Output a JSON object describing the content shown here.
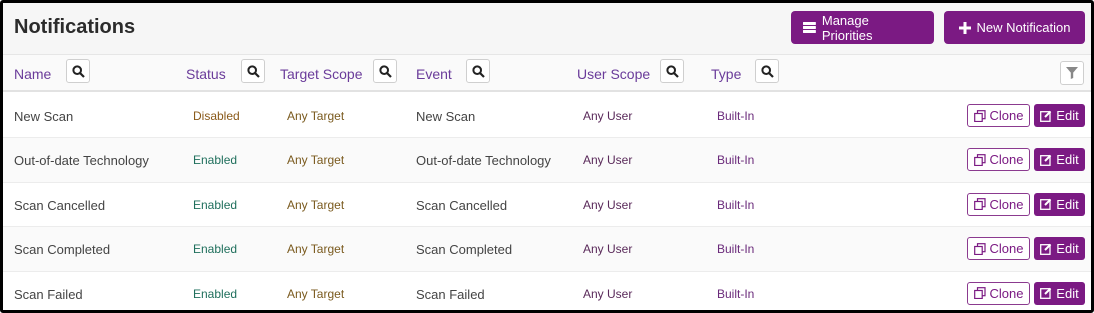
{
  "header": {
    "title": "Notifications",
    "manage_priorities_label": "Manage Priorities",
    "new_notification_label": "New Notification"
  },
  "columns": {
    "name": "Name",
    "status": "Status",
    "target_scope": "Target Scope",
    "event": "Event",
    "user_scope": "User Scope",
    "type": "Type"
  },
  "actions": {
    "clone_label": "Clone",
    "edit_label": "Edit"
  },
  "rows": [
    {
      "name": "New Scan",
      "status": "Disabled",
      "target_scope": "Any Target",
      "event": "New Scan",
      "user_scope": "Any User",
      "type": "Built-In"
    },
    {
      "name": "Out-of-date Technology",
      "status": "Enabled",
      "target_scope": "Any Target",
      "event": "Out-of-date Technology",
      "user_scope": "Any User",
      "type": "Built-In"
    },
    {
      "name": "Scan Cancelled",
      "status": "Enabled",
      "target_scope": "Any Target",
      "event": "Scan Cancelled",
      "user_scope": "Any User",
      "type": "Built-In"
    },
    {
      "name": "Scan Completed",
      "status": "Enabled",
      "target_scope": "Any Target",
      "event": "Scan Completed",
      "user_scope": "Any User",
      "type": "Built-In"
    },
    {
      "name": "Scan Failed",
      "status": "Enabled",
      "target_scope": "Any Target",
      "event": "Scan Failed",
      "user_scope": "Any User",
      "type": "Built-In"
    }
  ],
  "icons": {
    "manage_priorities": "list-icon",
    "new_notification": "plus-icon",
    "column_search": "search-icon",
    "filter": "filter-icon",
    "clone": "copy-icon",
    "edit": "edit-icon"
  },
  "colors": {
    "brand": "#7b1a83",
    "header_link": "#6a3b9a",
    "enabled": "#1f6f5c",
    "disabled": "#8a5a1a"
  }
}
